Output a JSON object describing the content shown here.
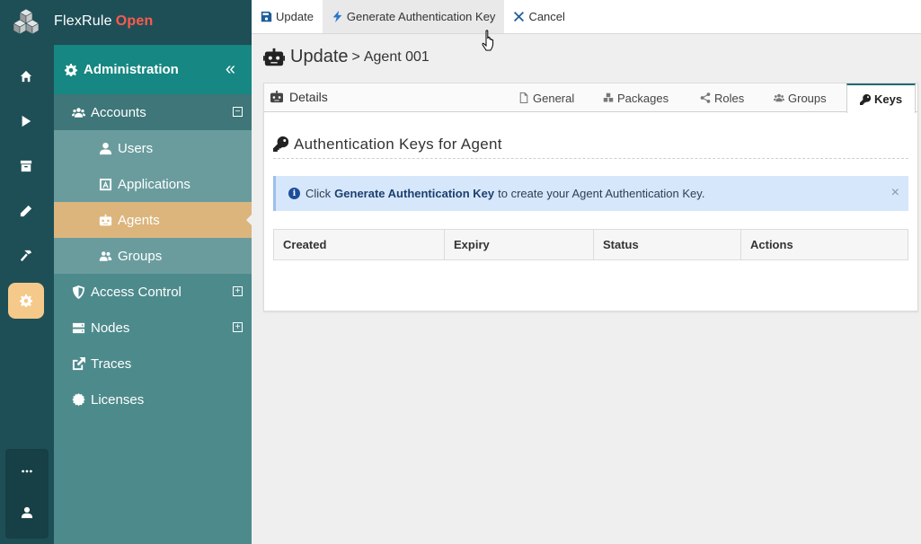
{
  "brand": {
    "name": "FlexRule",
    "edition": "Open"
  },
  "rail": {
    "items": [
      {
        "icon": "home-icon"
      },
      {
        "icon": "play-icon"
      },
      {
        "icon": "archive-icon"
      },
      {
        "icon": "pencil-icon"
      },
      {
        "icon": "hammer-icon"
      },
      {
        "icon": "gear-icon",
        "active": true
      }
    ],
    "bottom": [
      {
        "icon": "more-icon"
      },
      {
        "icon": "user-icon"
      }
    ]
  },
  "nav": {
    "header": "Administration",
    "collapse_icon": "«",
    "items": [
      {
        "label": "Accounts",
        "icon": "users-icon",
        "toggle": "⊟"
      },
      {
        "label": "Users",
        "icon": "user-icon"
      },
      {
        "label": "Applications",
        "icon": "app-icon"
      },
      {
        "label": "Agents",
        "icon": "robot-icon",
        "selected": true
      },
      {
        "label": "Groups",
        "icon": "users-icon"
      },
      {
        "label": "Access Control",
        "icon": "shield-icon",
        "toggle": "⊞"
      },
      {
        "label": "Nodes",
        "icon": "server-icon",
        "toggle": "⊞"
      },
      {
        "label": "Traces",
        "icon": "external-link-icon"
      },
      {
        "label": "Licenses",
        "icon": "certificate-icon"
      }
    ]
  },
  "toolbar": {
    "update": "Update",
    "generate": "Generate Authentication Key",
    "cancel": "Cancel"
  },
  "page": {
    "title": "Update",
    "separator": ">",
    "subtitle": "Agent 001"
  },
  "tabs": {
    "details": "Details",
    "items": [
      "General",
      "Packages",
      "Roles",
      "Groups",
      "Keys"
    ],
    "active": "Keys"
  },
  "keys": {
    "title": "Authentication Keys for Agent",
    "alert": {
      "prefix": "Click",
      "link": "Generate Authentication Key",
      "suffix": "to create your Agent Authentication Key.",
      "close": "×"
    },
    "columns": [
      "Created",
      "Expiry",
      "Status",
      "Actions"
    ]
  },
  "colors": {
    "rail": "#1e4f57",
    "nav_header": "#168782",
    "selected": "#dcb57d",
    "brand_accent": "#ff5a4e",
    "alert_bg": "#d6e7fb"
  }
}
